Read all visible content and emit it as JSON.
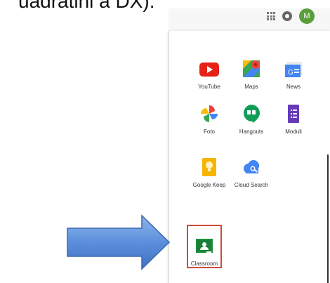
{
  "caption": "uadratini a DX).",
  "header": {
    "avatar_initial": "M"
  },
  "apps": [
    {
      "label": "YouTube",
      "icon": "youtube-icon"
    },
    {
      "label": "Maps",
      "icon": "maps-icon"
    },
    {
      "label": "News",
      "icon": "news-icon"
    },
    {
      "label": "Foto",
      "icon": "photos-icon"
    },
    {
      "label": "Hangouts",
      "icon": "hangouts-icon"
    },
    {
      "label": "Moduli",
      "icon": "forms-icon"
    },
    {
      "label": "Google Keep",
      "icon": "keep-icon"
    },
    {
      "label": "Cloud Search",
      "icon": "cloud-search-icon"
    },
    {
      "label": "Classroom",
      "icon": "classroom-icon"
    }
  ],
  "colors": {
    "highlight": "#d04a3a",
    "arrow": "#4a7fd4",
    "youtube": "#e62117",
    "classroom": "#1e8e3e"
  }
}
